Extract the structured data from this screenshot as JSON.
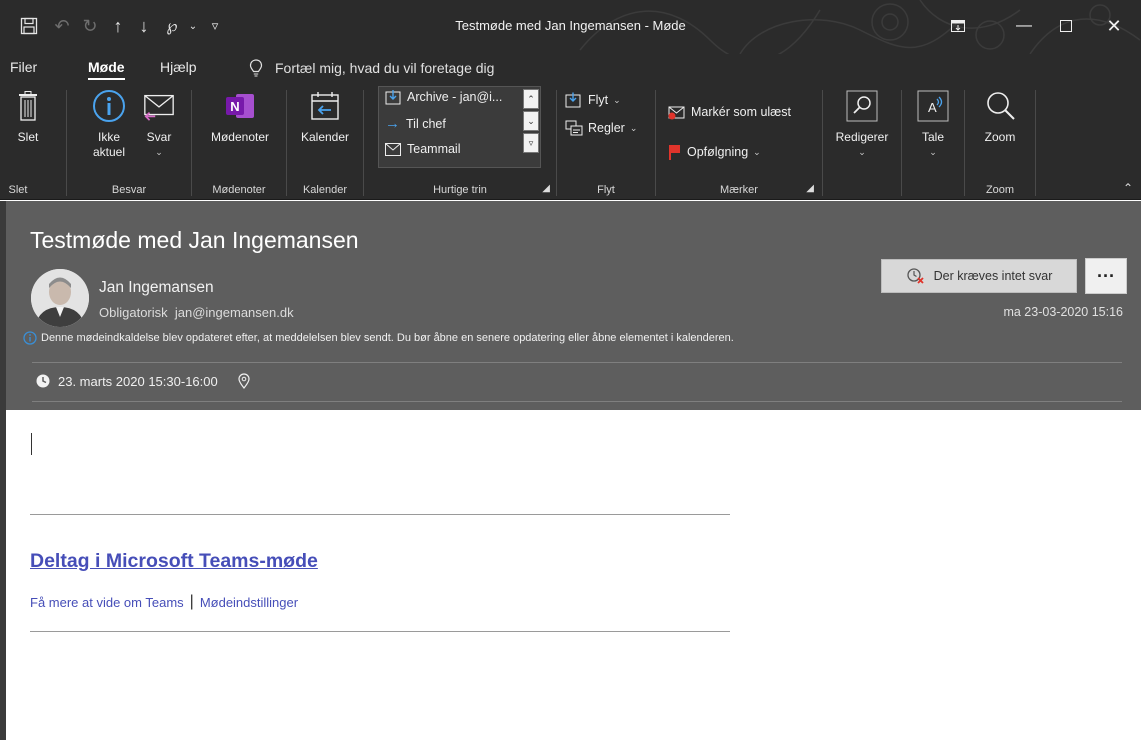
{
  "window": {
    "title": "Testmøde med Jan Ingemansen  -  Møde"
  },
  "ribbon_tabs": [
    {
      "label": "Filer"
    },
    {
      "label": "Møde"
    },
    {
      "label": "Hjælp"
    }
  ],
  "tell_me": "Fortæl mig, hvad du vil foretage dig",
  "ribbon": {
    "delete_label": "Slet",
    "not_relevant_line1": "Ikke",
    "not_relevant_line2": "aktuel",
    "reply_label": "Svar",
    "meeting_notes_label": "Mødenoter",
    "calendar_label": "Kalender",
    "quick_steps": [
      {
        "label": "Archive - jan@i..."
      },
      {
        "label": "Til chef"
      },
      {
        "label": "Teammail"
      }
    ],
    "move_label": "Flyt",
    "rules_label": "Regler",
    "mark_unread_label": "Markér som ulæst",
    "follow_up_label": "Opfølgning",
    "edit_label": "Redigerer",
    "speech_label": "Tale",
    "zoom_label": "Zoom",
    "groups": {
      "delete": "Slet",
      "respond": "Besvar",
      "meeting_notes": "Mødenoter",
      "calendar": "Kalender",
      "quick_steps": "Hurtige trin",
      "move": "Flyt",
      "tags": "Mærker",
      "zoom": "Zoom"
    }
  },
  "meeting": {
    "subject": "Testmøde med Jan Ingemansen",
    "sender": "Jan Ingemansen",
    "attendance": "Obligatorisk",
    "email": "jan@ingemansen.dk",
    "sent": "ma 23-03-2020 15:16",
    "no_response_label": "Der kræves intet svar",
    "more_label": "···",
    "info": "Denne mødeindkaldelse blev opdateret efter, at meddelelsen blev sendt. Du bør åbne en senere opdatering eller åbne elementet i kalenderen.",
    "when": "23. marts 2020 15:30-16:00"
  },
  "body": {
    "join_link": "Deltag i Microsoft Teams-møde",
    "learn_more": "Få mere at vide om Teams",
    "separator": "|",
    "meeting_options": "Mødeindstillinger"
  },
  "colors": {
    "titlebar": "#2b2b2b",
    "header": "#5e5e5e",
    "link": "#464eb8",
    "onenote": "#7719aa",
    "flag": "#e0342b",
    "info": "#3a8fd6"
  }
}
